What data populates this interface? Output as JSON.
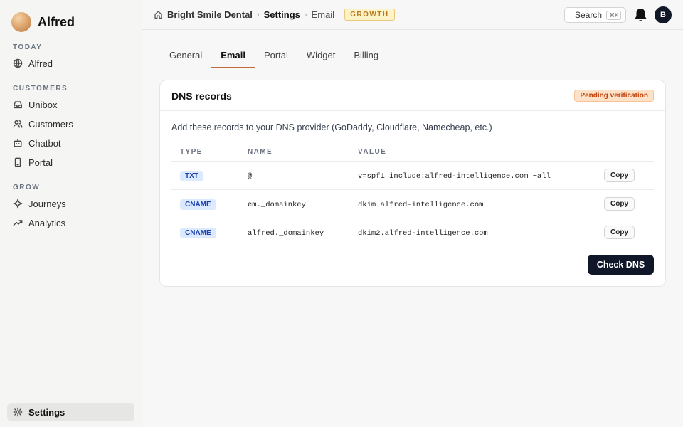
{
  "brand": {
    "name": "Alfred"
  },
  "sidebar": {
    "sections": [
      "TODAY",
      "CUSTOMERS",
      "GROW"
    ],
    "items": [
      {
        "label": "Alfred",
        "icon": "globe-icon"
      },
      {
        "label": "Unibox",
        "icon": "inbox-icon"
      },
      {
        "label": "Customers",
        "icon": "users-icon"
      },
      {
        "label": "Chatbot",
        "icon": "bot-icon"
      },
      {
        "label": "Portal",
        "icon": "phone-icon"
      },
      {
        "label": "Journeys",
        "icon": "sparkle-icon"
      },
      {
        "label": "Analytics",
        "icon": "trend-icon"
      }
    ],
    "footer": {
      "label": "Settings",
      "icon": "gear-icon"
    }
  },
  "header": {
    "org": "Bright Smile Dental",
    "section": "Settings",
    "page": "Email",
    "plan": "GROWTH",
    "search_label": "Search",
    "search_shortcut": "⌘K",
    "avatar_initial": "B"
  },
  "tabs": [
    {
      "label": "General"
    },
    {
      "label": "Email"
    },
    {
      "label": "Portal"
    },
    {
      "label": "Widget"
    },
    {
      "label": "Billing"
    }
  ],
  "dns": {
    "title": "DNS records",
    "status": "Pending verification",
    "instructions": "Add these records to your DNS provider (GoDaddy, Cloudflare, Namecheap, etc.)",
    "columns": [
      "TYPE",
      "NAME",
      "VALUE"
    ],
    "rows": [
      {
        "type": "TXT",
        "name": "@",
        "value": "v=spf1 include:alfred-intelligence.com ~all",
        "copy": "Copy"
      },
      {
        "type": "CNAME",
        "name": "em._domainkey",
        "value": "dkim.alfred-intelligence.com",
        "copy": "Copy"
      },
      {
        "type": "CNAME",
        "name": "alfred._domainkey",
        "value": "dkim2.alfred-intelligence.com",
        "copy": "Copy"
      }
    ],
    "action": "Check DNS"
  },
  "colors": {
    "accent": "#c26b3a",
    "primary_button": "#0f1729",
    "plan_badge": "#b7791f",
    "pending": "#c2410c",
    "type_badge": "#1e40af"
  }
}
